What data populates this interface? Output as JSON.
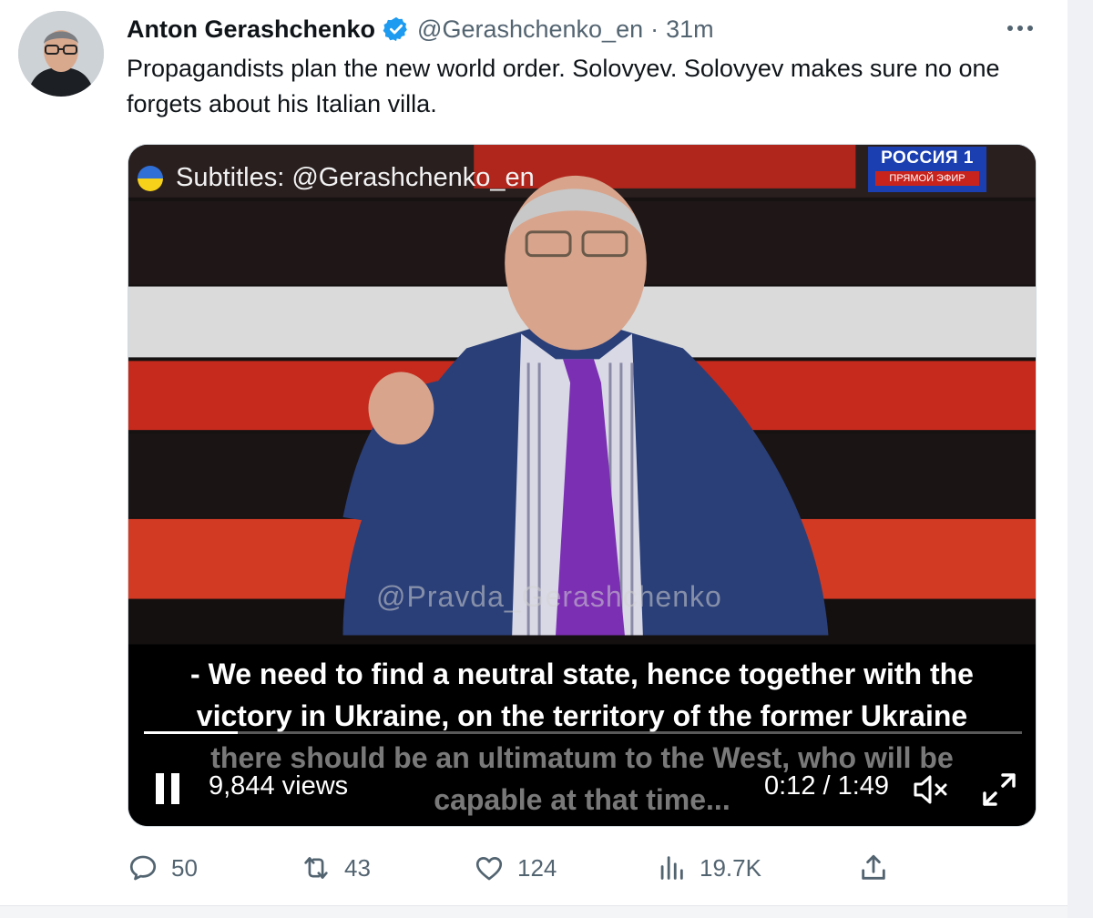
{
  "tweet": {
    "author_name": "Anton Gerashchenko",
    "handle": "@Gerashchenko_en",
    "separator": "·",
    "time": "31m",
    "text": "Propagandists plan the new world order. Solovyev. Solovyev makes sure no one forgets about his Italian villa."
  },
  "video": {
    "subtitle_tag": "Subtitles: @Gerashchenko_en",
    "channel_name": "РОССИЯ 1",
    "channel_live": "ПРЯМОЙ ЭФИР",
    "watermark": "@Pravda_Gerashchenko",
    "captions": [
      "- We need to find a neutral state, hence together with the",
      "victory in Ukraine, on the territory of the former Ukraine",
      "there should be an ultimatum to the West, who will be",
      "capable at that time..."
    ],
    "views": "9,844 views",
    "timecode": "0:12 / 1:49",
    "progress": 0.107,
    "colors": {
      "backdrop_red": "#c62a1c",
      "suit": "#2a3f78",
      "tie": "#7b2fb3"
    }
  },
  "actions": {
    "replies": "50",
    "retweets": "43",
    "likes": "124",
    "views": "19.7K"
  },
  "icons": {
    "verified": "verified-badge-icon",
    "more": "more-options-icon",
    "reply": "reply-icon",
    "retweet": "retweet-icon",
    "like": "heart-icon",
    "analytics": "analytics-icon",
    "share": "share-icon",
    "pause": "pause-icon",
    "mute": "muted-speaker-icon",
    "fullscreen": "fullscreen-icon"
  }
}
